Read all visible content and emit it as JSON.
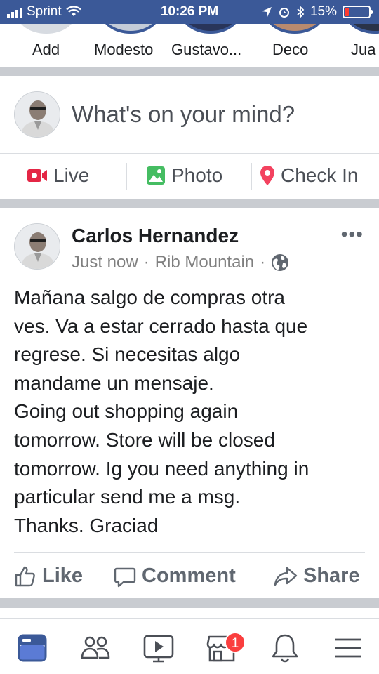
{
  "status_bar": {
    "carrier": "Sprint",
    "time": "10:26 PM",
    "battery": "15%"
  },
  "stories": [
    {
      "label": "Add"
    },
    {
      "label": "Modesto"
    },
    {
      "label": "Gustavo..."
    },
    {
      "label": "Deco"
    },
    {
      "label": "Jua"
    }
  ],
  "composer": {
    "prompt": "What's on your mind?"
  },
  "composer_actions": {
    "live": "Live",
    "photo": "Photo",
    "checkin": "Check In"
  },
  "post": {
    "author": "Carlos Hernandez",
    "time": "Just now",
    "location": "Rib Mountain",
    "dot": "·",
    "body_lines": [
      "Mañana salgo de compras otra",
      "ves. Va a estar cerrado hasta que",
      "regrese. Si necesitas algo",
      "mandame un mensaje.",
      "Going out shopping again",
      "tomorrow. Store will be closed",
      "tomorrow. Ig you need anything in",
      "particular send me a msg.",
      "Thanks. Graciad"
    ],
    "actions": {
      "like": "Like",
      "comment": "Comment",
      "share": "Share"
    }
  },
  "bottom_nav": {
    "notification_badge": "1"
  },
  "colors": {
    "facebook_blue": "#3b5998",
    "live_red": "#e42645",
    "photo_green": "#45bd62",
    "checkin_pink": "#f3425f",
    "divider_gray": "#c9ccd1",
    "badge_red": "#fa3e3e"
  },
  "icons": {
    "live": "live-video-icon",
    "photo": "photo-icon",
    "checkin": "location-pin-icon",
    "like": "thumbs-up-icon",
    "comment": "comment-bubble-icon",
    "share": "share-arrow-icon",
    "privacy": "globe-icon",
    "more": "more-dots-icon",
    "nav": [
      "news-feed-icon",
      "friends-icon",
      "watch-icon",
      "marketplace-icon",
      "notifications-bell-icon",
      "menu-icon"
    ]
  }
}
